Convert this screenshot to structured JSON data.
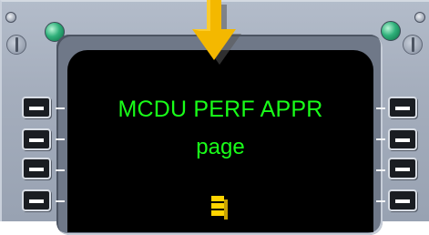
{
  "screen": {
    "line1": "MCDU PERF APPR",
    "line2": "page"
  },
  "colors": {
    "screen_text": "#19ff19",
    "pointer_arrow": "#f4b800",
    "indicator_led": "#2fb07a"
  },
  "line_select_keys": {
    "left_count": 4,
    "right_count": 4
  },
  "icons": [
    "pointer-arrow-icon",
    "annunciator-led",
    "bezel-screw",
    "line-select-key",
    "cursor-marker-icon"
  ]
}
